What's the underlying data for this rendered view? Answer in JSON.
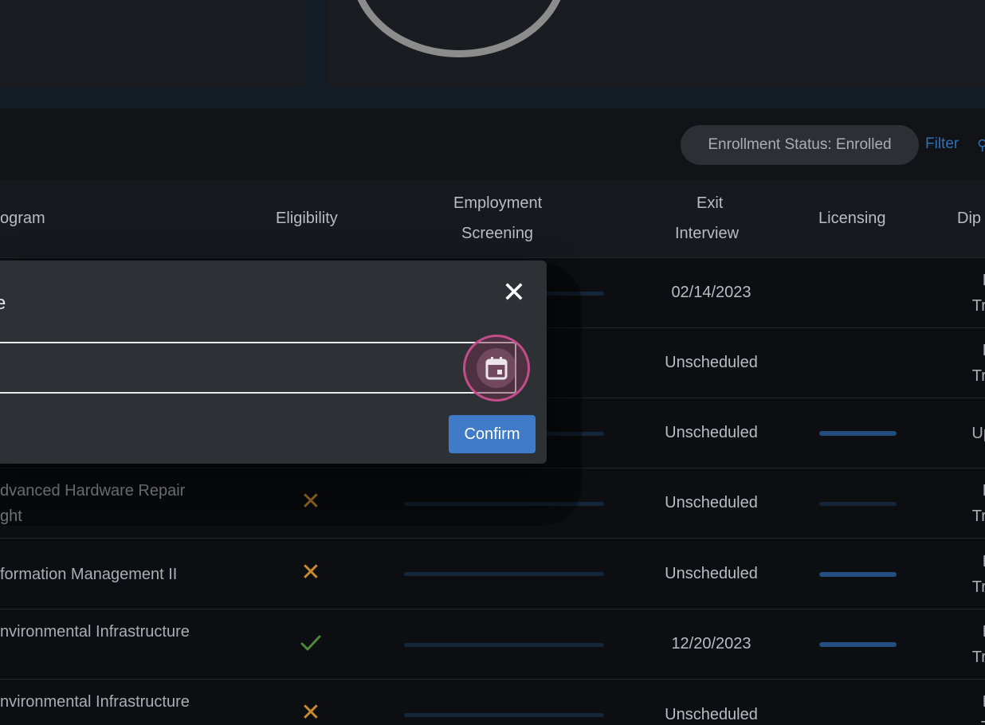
{
  "filter": {
    "chip_label": "Enrollment Status: Enrolled",
    "filter_link": "Filter"
  },
  "table": {
    "headers": {
      "program": "ogram",
      "eligibility": "Eligibility",
      "employment_line1": "Employment",
      "employment_line2": "Screening",
      "exit_line1": "Exit",
      "exit_line2": "Interview",
      "licensing": "Licensing",
      "diploma": "Dip"
    },
    "rows": [
      {
        "exit": "02/14/2023",
        "dip1": "N",
        "dip2": "Tran"
      },
      {
        "exit": "Unscheduled",
        "dip1": "N",
        "dip2": "Tran"
      },
      {
        "exit": "Unscheduled",
        "dip1": "Uplo",
        "dip2": ""
      },
      {
        "program1": "dvanced Hardware Repair",
        "program2": "ght",
        "eligibility": "x",
        "exit": "Unscheduled",
        "dip1": "N",
        "dip2": "Tran"
      },
      {
        "program1": "formation Management II",
        "program2": "",
        "eligibility": "x",
        "exit": "Unscheduled",
        "dip1": "N",
        "dip2": "Tran"
      },
      {
        "program1": "nvironmental Infrastructure",
        "program2": "",
        "eligibility": "check",
        "exit": "12/20/2023",
        "dip1": "N",
        "dip2": "Tran"
      },
      {
        "program1": "nvironmental Infrastructure",
        "program2": "",
        "eligibility": "x",
        "exit": "Unscheduled",
        "dip1": "N",
        "dip2": "Tr"
      }
    ]
  },
  "dialog": {
    "title": "e",
    "date_value": "",
    "confirm_label": "Confirm",
    "close_icon": "close-icon",
    "calendar_icon": "calendar-icon"
  },
  "colors": {
    "accent": "#3f7bc8",
    "warning": "#c98b2e",
    "success": "#4c8a3a",
    "focus_ring": "#c24d8a"
  }
}
